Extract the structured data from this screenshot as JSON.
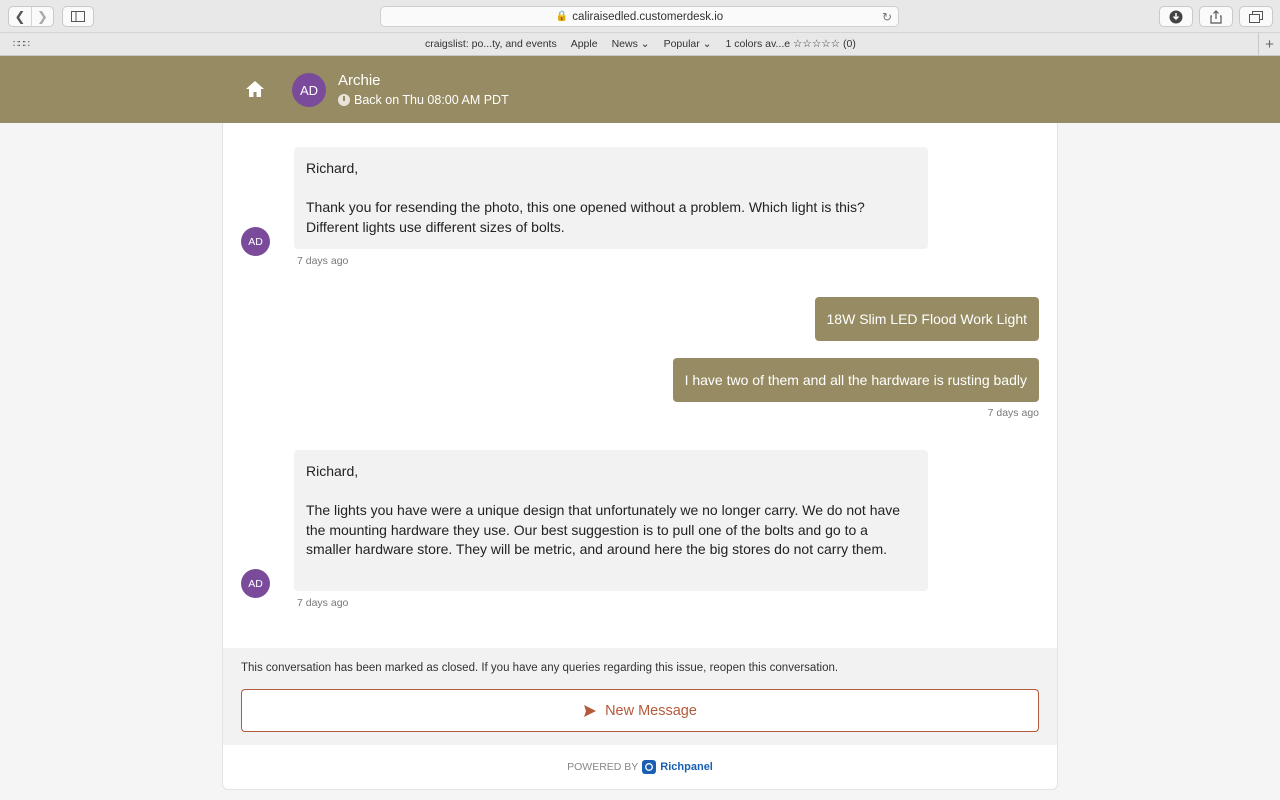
{
  "browser": {
    "url": "caliraisedled.customerdesk.io",
    "bookmarks": [
      "craigslist: po...ty, and events",
      "Apple",
      "News",
      "Popular",
      "1 colors av...e ☆☆☆☆☆ (0)"
    ]
  },
  "header": {
    "avatar_initials": "AD",
    "agent_name": "Archie",
    "status": "Back on Thu 08:00 AM PDT"
  },
  "messages": [
    {
      "direction": "incoming",
      "avatar": "AD",
      "paragraphs": [
        "Richard,",
        "Thank you for resending the photo, this one opened without a problem. Which light is this? Different lights use different sizes of bolts."
      ],
      "time": "7 days ago"
    },
    {
      "direction": "outgoing",
      "text": "18W Slim LED Flood Work Light"
    },
    {
      "direction": "outgoing",
      "text": "I have two of them and all the hardware is rusting badly",
      "time": "7 days ago"
    },
    {
      "direction": "incoming",
      "avatar": "AD",
      "paragraphs": [
        "Richard,",
        "The lights you have were a unique design that unfortunately we no longer carry. We do not have the mounting hardware they use. Our best suggestion is to pull one of the bolts and go to a smaller hardware store. They will be metric, and around here the big stores do not carry them."
      ],
      "time": "7 days ago"
    }
  ],
  "closed_notice": "This conversation has been marked as closed. If you have any queries regarding this issue, reopen this conversation.",
  "new_message_label": "New Message",
  "footer": {
    "powered_by": "POWERED BY",
    "brand": "Richpanel"
  },
  "colors": {
    "accent": "#968b62",
    "avatar": "#7a4b9a",
    "button": "#b4593b",
    "brand": "#1a5fb4"
  }
}
